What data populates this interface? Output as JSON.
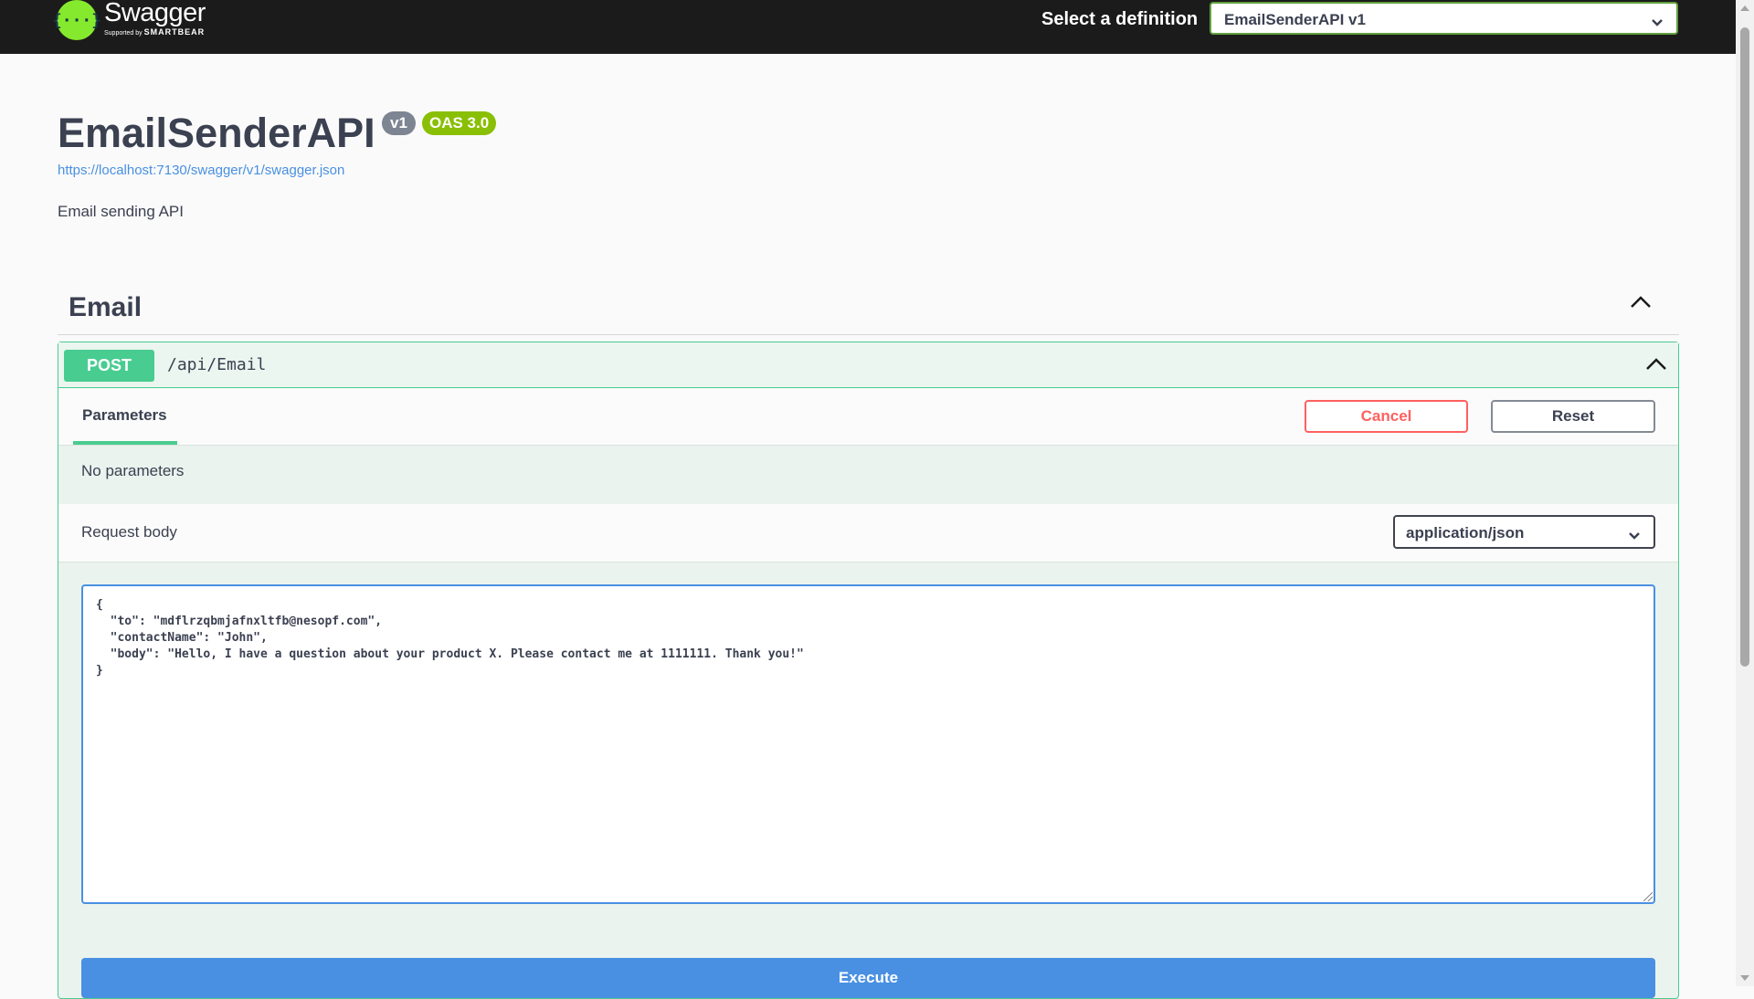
{
  "header": {
    "logo": {
      "name": "Swagger",
      "supported_by": "Supported by",
      "brand": "SMARTBEAR",
      "glyph": "{···}"
    },
    "definition_label": "Select a definition",
    "definition_selected": "EmailSenderAPI v1"
  },
  "info": {
    "title": "EmailSenderAPI",
    "version": "v1",
    "oas_version": "OAS 3.0",
    "spec_url": "https://localhost:7130/swagger/v1/swagger.json",
    "description": "Email sending API"
  },
  "tag": {
    "name": "Email",
    "toggle_icon": "chevron-up-icon"
  },
  "operation": {
    "method": "POST",
    "path": "/api/Email",
    "tab_parameters": "Parameters",
    "cancel_label": "Cancel",
    "reset_label": "Reset",
    "no_parameters": "No parameters",
    "request_body_label": "Request body",
    "content_type": "application/json",
    "request_body": "{\n  \"to\": \"mdflrzqbmjafnxltfb@nesopf.com\",\n  \"contactName\": \"John\",\n  \"body\": \"Hello, I have a question about your product X. Please contact me at 1111111. Thank you!\"\n}",
    "execute_label": "Execute"
  },
  "colors": {
    "topbar": "#1b1b1b",
    "brand_green": "#85ea2d",
    "post_green": "#49cc90",
    "cancel_red": "#ff6060",
    "execute_blue": "#4990e2",
    "oas_badge": "#89bf04",
    "version_badge": "#7d8492"
  }
}
